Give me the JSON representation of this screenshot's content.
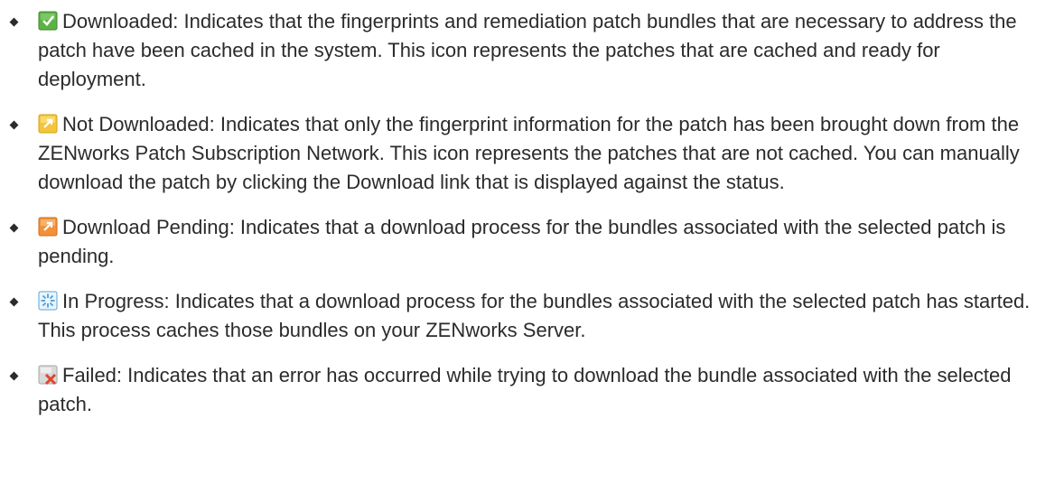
{
  "items": [
    {
      "icon": "downloaded-icon",
      "text": "Downloaded: Indicates that the fingerprints and remediation patch bundles that are necessary to address the patch have been cached in the system. This icon represents the patches that are cached and ready for deployment."
    },
    {
      "icon": "not-downloaded-icon",
      "text": "Not Downloaded: Indicates that only the fingerprint information for the patch has been brought down from the ZENworks Patch Subscription Network. This icon represents the patches that are not cached. You can manually download the patch by clicking the Download link that is displayed against the status."
    },
    {
      "icon": "download-pending-icon",
      "text": "Download Pending: Indicates that a download process for the bundles associated with the selected patch is pending."
    },
    {
      "icon": "in-progress-icon",
      "text": "In Progress: Indicates that a download process for the bundles associated with the selected patch has started. This process caches those bundles on your ZENworks Server."
    },
    {
      "icon": "failed-icon",
      "text": "Failed: Indicates that an error has occurred while trying to download the bundle associated with the selected patch."
    }
  ],
  "colors": {
    "downloaded": "#4fa33a",
    "not_downloaded": "#f2c230",
    "download_pending": "#f08a24",
    "in_progress": "#4a9fd8",
    "failed": "#e0452f"
  }
}
